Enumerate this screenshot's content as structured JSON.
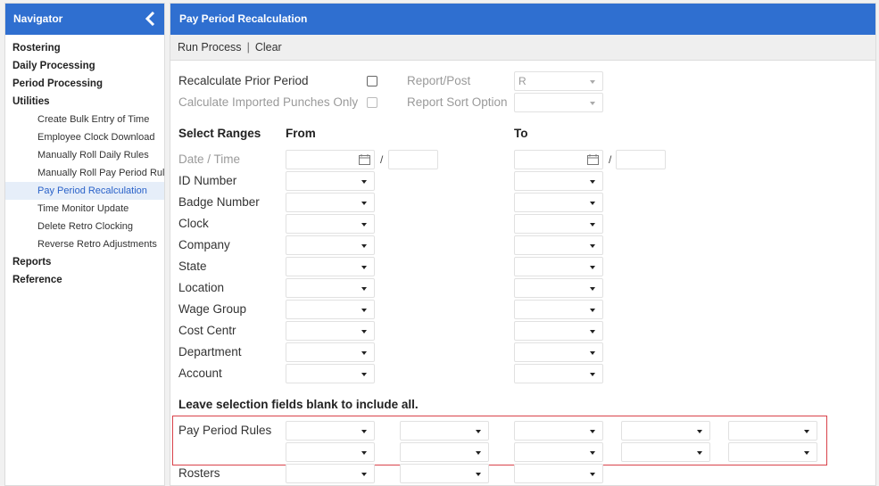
{
  "nav": {
    "title": "Navigator",
    "items": [
      {
        "label": "Rostering"
      },
      {
        "label": "Daily Processing"
      },
      {
        "label": "Period Processing"
      },
      {
        "label": "Utilities"
      }
    ],
    "utilities": [
      "Create Bulk Entry of Time",
      "Employee Clock Download",
      "Manually Roll Daily Rules",
      "Manually Roll Pay Period Rule",
      "Pay Period Recalculation",
      "Time Monitor Update",
      "Delete Retro Clocking",
      "Reverse Retro Adjustments"
    ],
    "bottom": [
      "Reports",
      "Reference"
    ]
  },
  "page": {
    "title": "Pay Period Recalculation"
  },
  "toolbar": {
    "run": "Run Process",
    "separator": "|",
    "clear": "Clear"
  },
  "options": {
    "recalc_prior": "Recalculate Prior Period",
    "calc_imported": "Calculate Imported Punches Only",
    "report_post": "Report/Post",
    "report_post_value": "R",
    "report_sort": "Report Sort Option"
  },
  "ranges": {
    "heading": "Select Ranges",
    "from": "From",
    "to": "To",
    "date_time": "Date / Time",
    "slash": "/",
    "fields": [
      "ID Number",
      "Badge Number",
      "Clock",
      "Company",
      "State",
      "Location",
      "Wage Group",
      "Cost Centr",
      "Department",
      "Account"
    ]
  },
  "note": "Leave selection fields blank to include all.",
  "pay_period_rules": "Pay Period Rules",
  "rosters": "Rosters"
}
